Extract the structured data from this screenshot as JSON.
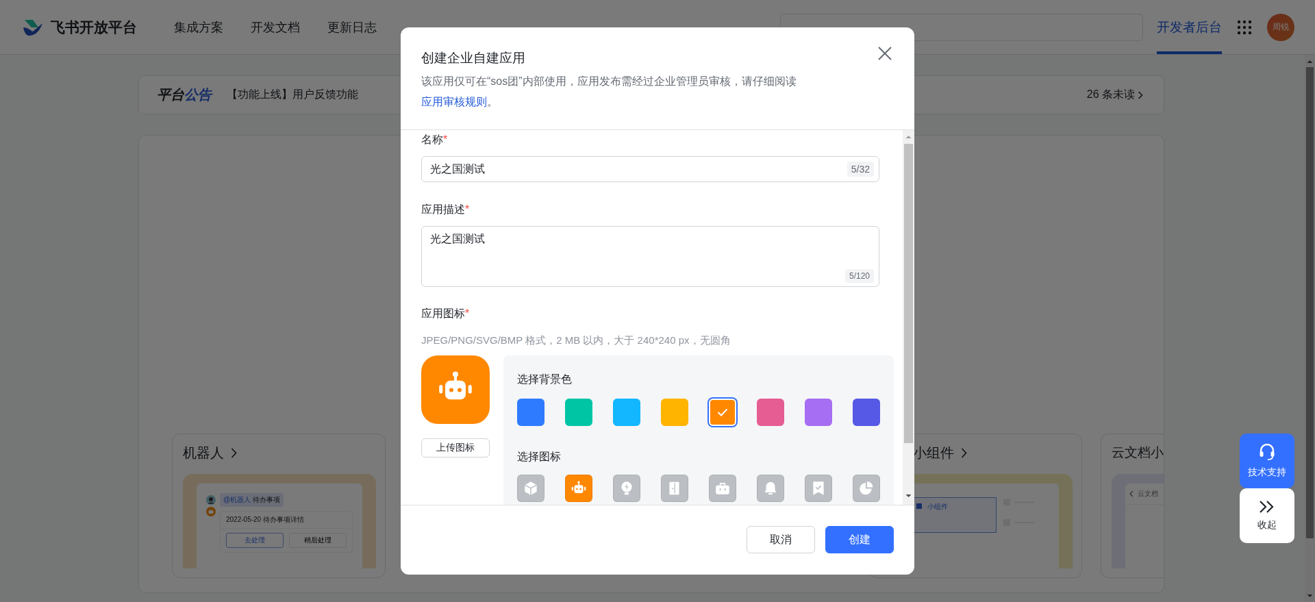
{
  "nav": {
    "logo": "飞书开放平台",
    "items": [
      {
        "label": "集成方案"
      },
      {
        "label": "开发文档"
      },
      {
        "label": "更新日志"
      }
    ],
    "console": {
      "label": "开发者后台",
      "selected": true
    },
    "avatar": "周锐"
  },
  "announcement": {
    "title": "平台**公告**",
    "message": "【功能上线】用户反馈功能",
    "unread": "26 条未读"
  },
  "cards": [
    {
      "kind": "bot",
      "title": "机器人",
      "mention": "**@机器人** 待办事项",
      "detail": "2022-05-20 待办事项详情",
      "actions": [
        "去处理",
        "稍后处理"
      ]
    },
    {
      "kind": "widget",
      "title": "小组件",
      "block": "小组件"
    },
    {
      "kind": "docs",
      "title": "云文档小",
      "header": "云文档"
    }
  ],
  "dialog": {
    "title": "创建企业自建应用",
    "description": "该应用仅可在“sos团”内部使用，应用发布需经过企业管理员审核，请仔细阅读 ",
    "link": "应用审核规则",
    "link_suffix": "。",
    "fields": [
      {
        "kind": "input",
        "label": "名称",
        "mark": "*",
        "value": "光之国测试",
        "counter": "5/32"
      },
      {
        "kind": "textarea",
        "label": "应用描述",
        "mark": "*",
        "value": "光之国测试",
        "counter": "5/120"
      }
    ],
    "icon_section": {
      "label": "应用图标",
      "mark": "*",
      "hint": "JPEG/PNG/SVG/BMP 格式，2 MB 以内，大于 240*240 px，无圆角",
      "upload": "上传图标",
      "bg_title": "选择背景色",
      "colors": [
        {
          "color": "#2f7bff",
          "selected": false
        },
        {
          "color": "#00c5a5",
          "selected": false
        },
        {
          "color": "#12b7ff",
          "selected": false
        },
        {
          "color": "#ffb400",
          "selected": false
        },
        {
          "color": "#ff8800",
          "selected": true
        },
        {
          "color": "#e55d93",
          "selected": false
        },
        {
          "color": "#a66ef2",
          "selected": false
        },
        {
          "color": "#5559e5",
          "selected": false
        }
      ],
      "icon_title": "选择图标",
      "icons": [
        {
          "kind": "cube",
          "selected": false
        },
        {
          "kind": "robot",
          "selected": true
        },
        {
          "kind": "bulb",
          "selected": false
        },
        {
          "kind": "door",
          "selected": false
        },
        {
          "kind": "briefcase",
          "selected": false
        },
        {
          "kind": "bell",
          "selected": false
        },
        {
          "kind": "bookmark",
          "selected": false
        },
        {
          "kind": "pie",
          "selected": false
        }
      ]
    },
    "cancel": "取消",
    "confirm": "创建"
  },
  "float": {
    "support": "技术支持",
    "collapse": "收起"
  }
}
